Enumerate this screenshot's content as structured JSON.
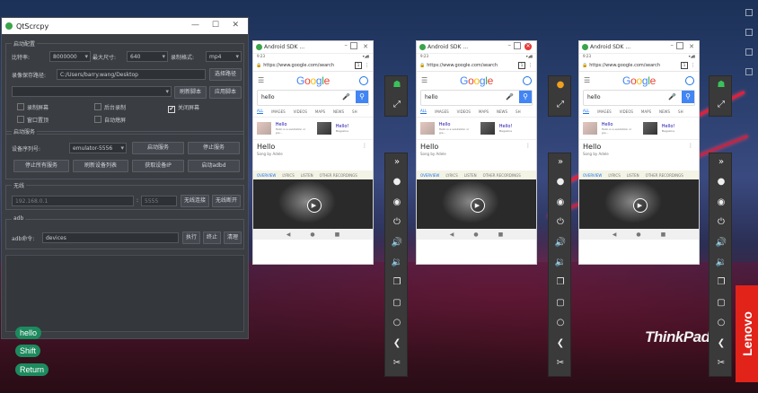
{
  "qtscrcpy": {
    "title": "QtScrcpy",
    "start_config_group": "启动配置",
    "bitrate_label": "比特率:",
    "bitrate_value": "8000000",
    "max_size_label": "最大尺寸:",
    "max_size_value": "640",
    "record_format_label": "录制格式:",
    "record_format_value": "mp4",
    "record_save_label": "录像保存路径:",
    "record_save_path": "C:/Users/barry.wang/Desktop",
    "select_path_button": "选择路径",
    "refresh_script_button": "刷新脚本",
    "apply_script_button": "应用脚本",
    "checkboxes": [
      {
        "label": "录制屏幕",
        "checked": false
      },
      {
        "label": "后台录制",
        "checked": false
      },
      {
        "label": "关闭屏幕",
        "checked": true
      },
      {
        "label": "窗口置顶",
        "checked": false
      },
      {
        "label": "自动熄屏",
        "checked": false
      }
    ],
    "start_service_group": "启动服务",
    "device_serial_label": "设备序列号:",
    "device_serial_value": "emulator-5556",
    "start_service_button": "启动服务",
    "stop_service_button": "停止服务",
    "stop_all_button": "停止所有服务",
    "refresh_devices_button": "刷新设备列表",
    "get_ip_button": "获取设备IP",
    "start_adbd_button": "启动adbd",
    "wireless_group": "无线",
    "ip_placeholder": "192.168.0.1",
    "port_placeholder": "5555",
    "wireless_connect_button": "无线连接",
    "wireless_disconnect_button": "无线断开",
    "adb_group": "adb",
    "adb_cmd_label": "adb命令:",
    "adb_cmd_value": "devices",
    "execute_button": "执行",
    "terminate_button": "终止",
    "clear_button": "清理"
  },
  "keyboard_buttons": [
    "hello",
    "Shift",
    "Return"
  ],
  "phones": [
    {
      "title": "Android SDK ...",
      "time": "9:23",
      "url": "https://www.google.com/search",
      "query": "hello",
      "tabs": [
        "ALL",
        "IMAGES",
        "VIDEOS",
        "MAPS",
        "NEWS",
        "SH"
      ],
      "result1_title": "Hello",
      "result1_sub": "Hello is a salutation or gre...",
      "result2_title": "Hello!",
      "result2_sub": "Magazine",
      "knowledge_title": "Hello",
      "knowledge_sub": "Song by Adele",
      "ktabs": [
        "OVERVIEW",
        "LYRICS",
        "LISTEN",
        "OTHER RECORDINGS"
      ]
    },
    {
      "title": "Android SDK ...",
      "time": "9:23",
      "url": "https://www.google.com/search",
      "query": "hello",
      "tabs": [
        "ALL",
        "IMAGES",
        "VIDEOS",
        "MAPS",
        "NEWS",
        "SH"
      ],
      "result1_title": "Hello",
      "result1_sub": "Hello is a salutation or gre...",
      "result2_title": "Hello!",
      "result2_sub": "Magazine",
      "knowledge_title": "Hello",
      "knowledge_sub": "Song by Adele",
      "ktabs": [
        "OVERVIEW",
        "LYRICS",
        "LISTEN",
        "OTHER RECORDINGS"
      ]
    },
    {
      "title": "Android SDK ...",
      "time": "9:23",
      "url": "https://www.google.com/search",
      "query": "hello",
      "tabs": [
        "ALL",
        "IMAGES",
        "VIDEOS",
        "MAPS",
        "NEWS",
        "SH"
      ],
      "result1_title": "Hello",
      "result1_sub": "Hello is a salutation or gre...",
      "result2_title": "Hello!",
      "result2_sub": "Magazine",
      "knowledge_title": "Hello",
      "knowledge_sub": "Song by Adele",
      "ktabs": [
        "OVERVIEW",
        "LYRICS",
        "LISTEN",
        "OTHER RECORDINGS"
      ]
    }
  ],
  "google_logo": "Google",
  "desktop": {
    "brand_text": "ThinkPad",
    "vendor_text": "Lenovo"
  }
}
